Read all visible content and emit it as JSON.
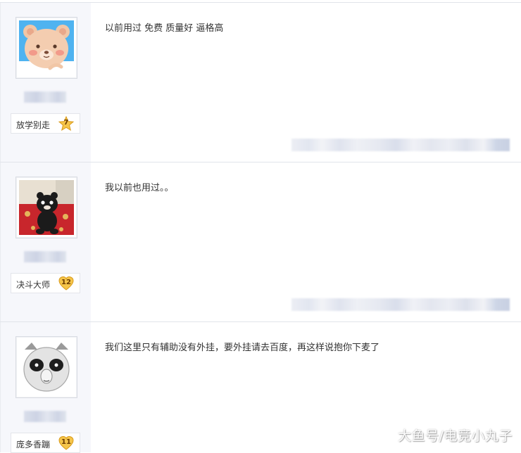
{
  "posts": [
    {
      "avatar_icon": "bear-avatar-icon",
      "title": "放学别走",
      "level": "7",
      "level_color": "#f0c040",
      "content": "以前用过 免费 质量好 逼格高"
    },
    {
      "avatar_icon": "kumamon-photo-avatar-icon",
      "title": "决斗大师",
      "level": "12",
      "level_color": "#f0c040",
      "content": "我以前也用过。。"
    },
    {
      "avatar_icon": "panda-meme-avatar-icon",
      "title": "庞多香蹦",
      "level": "11",
      "level_color": "#f0c040",
      "content": "我们这里只有辅助没有外挂，要外挂请去百度，再这样说抱你下麦了"
    }
  ],
  "watermark": "大鱼号/电竞小丸子"
}
